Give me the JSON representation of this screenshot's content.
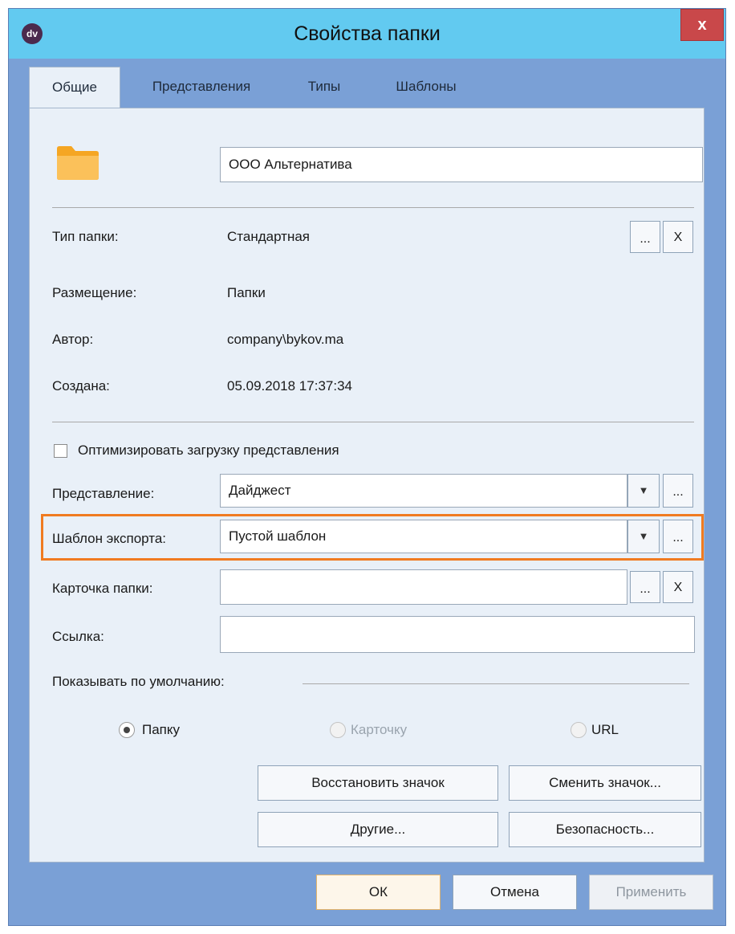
{
  "window": {
    "title": "Свойства папки",
    "app_icon_text": "dv",
    "close_label": "x"
  },
  "tabs": [
    {
      "label": "Общие",
      "active": true
    },
    {
      "label": "Представления",
      "active": false
    },
    {
      "label": "Типы",
      "active": false
    },
    {
      "label": "Шаблоны",
      "active": false
    }
  ],
  "general": {
    "folder_name": "ООО Альтернатива",
    "folder_icon_color": "#f5a623",
    "folder_type_label": "Тип папки:",
    "folder_type_value": "Стандартная",
    "placement_label": "Размещение:",
    "placement_value": "Папки",
    "author_label": "Автор:",
    "author_value": "company\\bykov.ma",
    "created_label": "Создана:",
    "created_value": "05.09.2018 17:37:34",
    "browse_label": "...",
    "clear_label": "X",
    "optimize_label": "Оптимизировать загрузку представления",
    "optimize_checked": false,
    "view_label": "Представление:",
    "view_value": "Дайджест",
    "export_template_label": "Шаблон экспорта:",
    "export_template_value": "Пустой шаблон",
    "folder_card_label": "Карточка папки:",
    "folder_card_value": "",
    "link_label": "Ссылка:",
    "link_value": "",
    "show_default_label": "Показывать по умолчанию:",
    "radio_folder_label": "Папку",
    "radio_card_label": "Карточку",
    "radio_url_label": "URL",
    "dropdown_arrow": "▼",
    "restore_icon_label": "Восстановить значок",
    "change_icon_label": "Сменить значок...",
    "other_label": "Другие...",
    "security_label": "Безопасность...",
    "highlight_color": "#f07b21"
  },
  "footer": {
    "ok_label": "ОК",
    "cancel_label": "Отмена",
    "apply_label": "Применить"
  }
}
